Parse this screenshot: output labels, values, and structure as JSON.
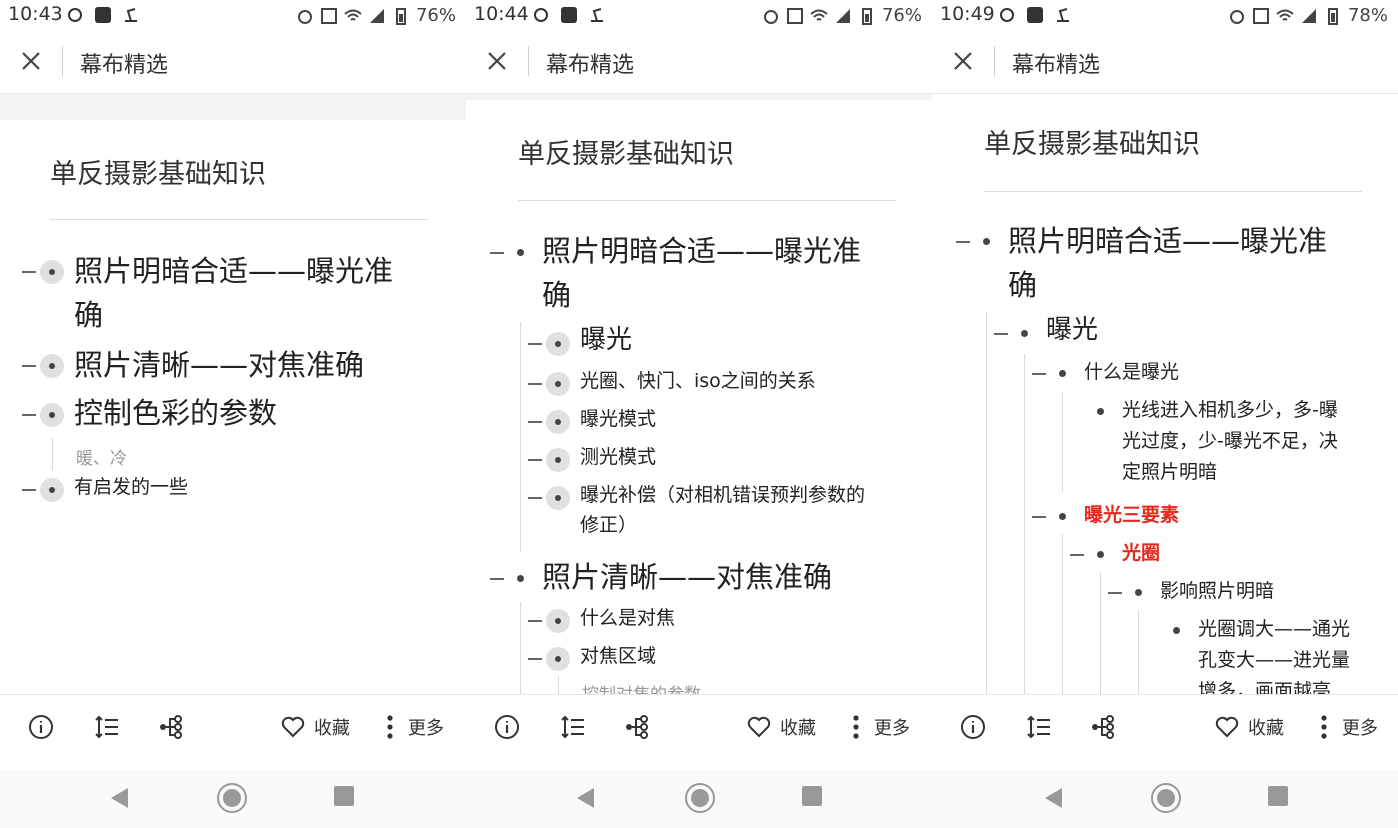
{
  "screens": [
    {
      "status": {
        "time": "10:43",
        "battery": "76%"
      },
      "header": {
        "title": "幕布精选"
      },
      "doc_title": "单反摄影基础知识",
      "items": [
        {
          "text": "照片明暗合适——曝光准",
          "text2": "确"
        },
        {
          "text": "照片清晰——对焦准确"
        },
        {
          "text": "控制色彩的参数",
          "note": "暖、冷"
        },
        {
          "text": "有启发的一些"
        }
      ],
      "toolbar": {
        "favorite": "收藏",
        "more": "更多"
      }
    },
    {
      "status": {
        "time": "10:44",
        "battery": "76%"
      },
      "header": {
        "title": "幕布精选"
      },
      "doc_title": "单反摄影基础知识",
      "items": [
        {
          "text": "照片明暗合适——曝光准",
          "text2": "确"
        },
        {
          "text": "曝光"
        },
        {
          "text": "光圈、快门、iso之间的关系"
        },
        {
          "text": "曝光模式"
        },
        {
          "text": "测光模式"
        },
        {
          "text": "曝光补偿（对相机错误预判参数的",
          "text2": "修正）"
        },
        {
          "text": "照片清晰——对焦准确"
        },
        {
          "text": "什么是对焦"
        },
        {
          "text": "对焦区域",
          "note": "控制对焦的参数"
        }
      ],
      "toolbar": {
        "favorite": "收藏",
        "more": "更多"
      }
    },
    {
      "status": {
        "time": "10:49",
        "battery": "78%"
      },
      "header": {
        "title": "幕布精选"
      },
      "doc_title": "单反摄影基础知识",
      "items": [
        {
          "text": "照片明暗合适——曝光准",
          "text2": "确"
        },
        {
          "text": "曝光"
        },
        {
          "text": "什么是曝光"
        },
        {
          "text": "光线进入相机多少，多-曝",
          "text2": "光过度，少-曝光不足，决",
          "text3": "定照片明暗"
        },
        {
          "text": "曝光三要素"
        },
        {
          "text": "光圈"
        },
        {
          "text": "影响照片明暗"
        },
        {
          "text": "光圈调大——通光",
          "text2": "孔变大——进光量",
          "text3": "增多，画面越亮"
        }
      ],
      "toolbar": {
        "favorite": "收藏",
        "more": "更多"
      }
    }
  ],
  "colors": {
    "accent_red": "#e8281e",
    "text": "#222222",
    "muted": "#999999"
  }
}
